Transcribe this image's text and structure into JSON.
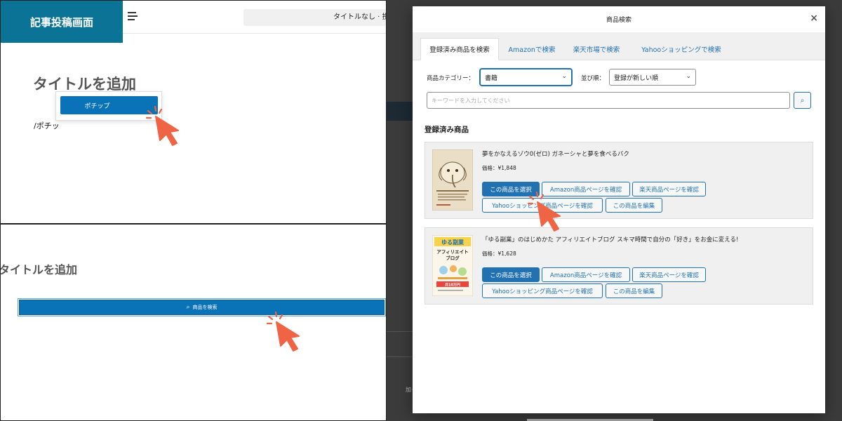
{
  "editor_top": {
    "panel_tag": "記事投稿画面",
    "hamburger_icon": "list-view-icon",
    "document_bar_text": "タイトルなし · 投稿",
    "title_placeholder": "タイトルを追加",
    "inserter_item_label": "ポチップ",
    "inserter_item_icon": "paw-icon",
    "typed_slash_command": "/ポチッ"
  },
  "editor_bottom": {
    "title_placeholder": "タイトルを追加",
    "search_button_label": "商品を検索",
    "search_button_icon": "search-icon"
  },
  "background_fragment": "加ってく",
  "modal": {
    "title": "商品検索",
    "close_icon": "close-icon",
    "tabs": [
      {
        "label": "登録済み商品を検索",
        "active": true
      },
      {
        "label": "Amazonで検索",
        "active": false
      },
      {
        "label": "楽天市場で検索",
        "active": false
      },
      {
        "label": "Yahooショッピングで検索",
        "active": false
      }
    ],
    "category_label": "商品カテゴリー：",
    "category_value": "書籍",
    "sort_label": "並び順：",
    "sort_value": "登録が新しい順",
    "keyword_placeholder": "キーワードを入力してください",
    "search_icon": "search-icon",
    "section_title": "登録済み商品",
    "products": [
      {
        "name": "夢をかなえるゾウ0(ゼロ) ガネーシャと夢を食べるバク",
        "price": "価格：¥1,848",
        "buttons": [
          "この商品を選択",
          "Amazon商品ページを確認",
          "楽天商品ページを確認",
          "Yahooショッピング商品ページを確認",
          "この商品を編集"
        ]
      },
      {
        "name": "「ゆる副業」のはじめかた アフィリエイトブログ スキマ時間で自分の「好き」をお金に変える!",
        "price": "価格：¥1,628",
        "buttons": [
          "この商品を選択",
          "Amazon商品ページを確認",
          "楽天商品ページを確認",
          "Yahooショッピング商品ページを確認",
          "この商品を編集"
        ]
      }
    ],
    "cover2_text": {
      "line1": "ゆる副業",
      "line2": "アフィリエイト",
      "line3": "ブログ",
      "badge": "月10万円"
    }
  },
  "colors": {
    "brand_teal": "#0a7396",
    "primary_blue": "#2271b1",
    "pointer_orange": "#ef6444",
    "overlay_gray": "#3b3b3b"
  },
  "pointer_icon": "hand-pointer-click-icon"
}
